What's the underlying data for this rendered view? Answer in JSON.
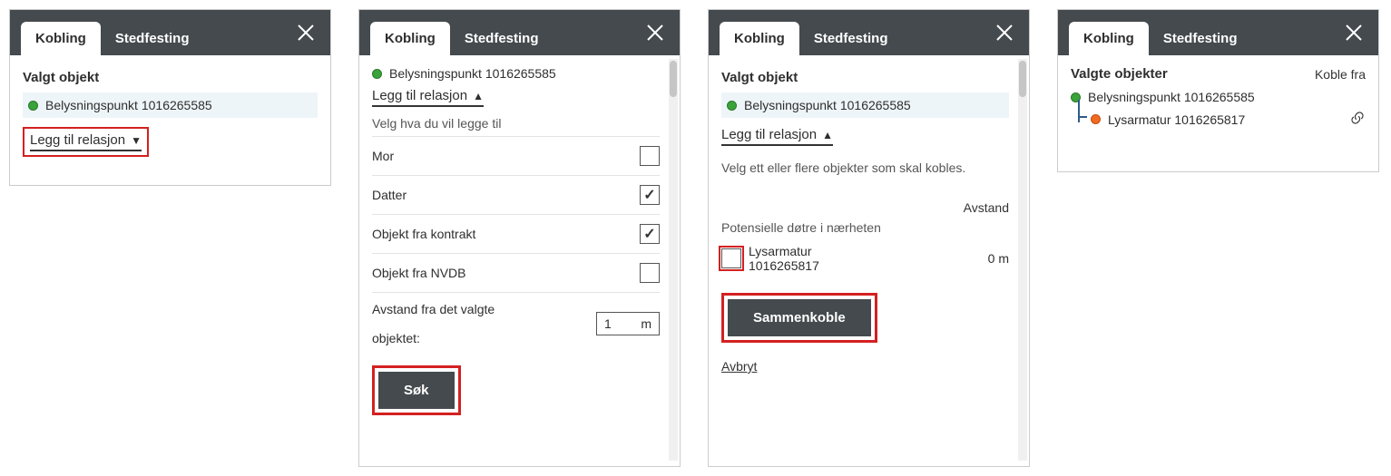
{
  "tabs": {
    "kobling": "Kobling",
    "stedfesting": "Stedfesting"
  },
  "selected_object": {
    "heading": "Valgt objekt",
    "name": "Belysningspunkt 1016265585"
  },
  "add_relation_label": "Legg til relasjon",
  "panel2": {
    "helper": "Velg hva du vil legge til",
    "options": {
      "mor": "Mor",
      "datter": "Datter",
      "objekt_kontrakt": "Objekt fra kontrakt",
      "objekt_nvdb": "Objekt fra NVDB"
    },
    "distance_label_1": "Avstand fra det valgte",
    "distance_label_2": "objektet:",
    "distance_value": "1",
    "distance_unit": "m",
    "search_btn": "Søk"
  },
  "panel3": {
    "helper": "Velg ett eller flere objekter som skal kobles.",
    "distance_header": "Avstand",
    "candidates_label": "Potensielle døtre i nærheten",
    "candidate_name": "Lysarmatur 1016265817",
    "candidate_dist": "0 m",
    "connect_btn": "Sammenkoble",
    "cancel": "Avbryt"
  },
  "panel4": {
    "heading": "Valgte objekter",
    "disconnect": "Koble fra",
    "parent": "Belysningspunkt 1016265585",
    "child": "Lysarmatur 1016265817"
  }
}
